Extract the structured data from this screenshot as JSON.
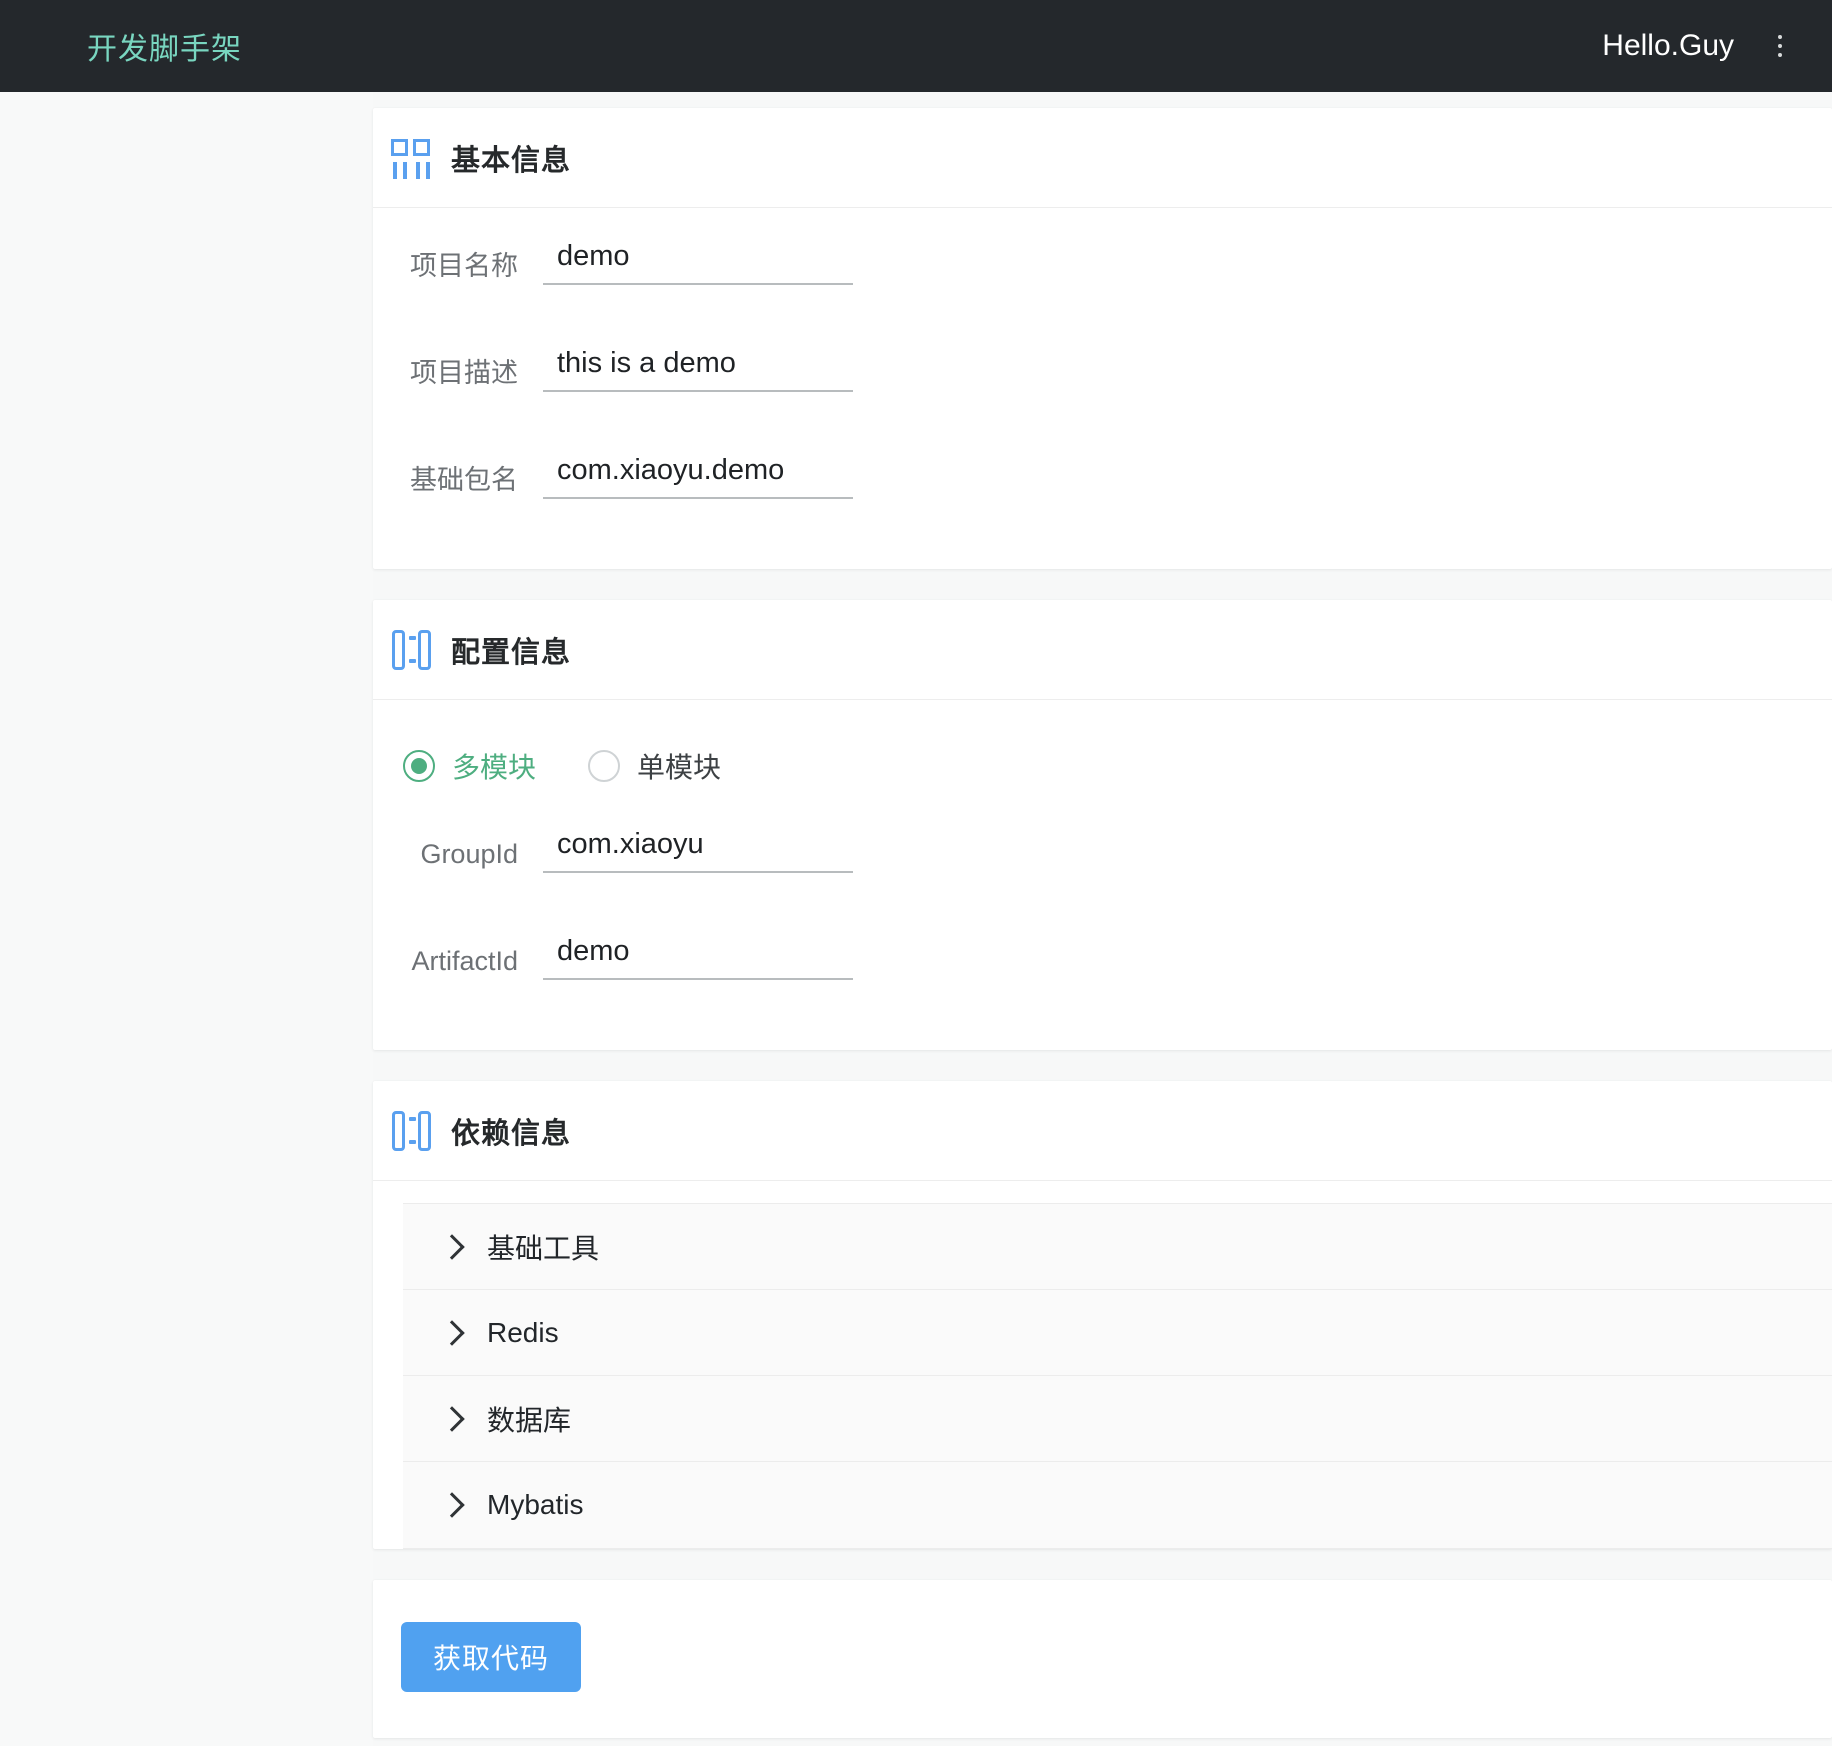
{
  "header": {
    "brand": "开发脚手架",
    "user": "Hello.Guy",
    "more_icon": "vertical-dots-icon"
  },
  "colors": {
    "navbar_bg": "#24282c",
    "brand_text": "#79d6c0",
    "icon_blue": "#5aa0ef",
    "radio_green": "#4eae80",
    "button_blue": "#50a1f0",
    "page_bg": "#f7f8f8"
  },
  "cards": {
    "basic": {
      "title": "基本信息",
      "icon": "form-layout-icon",
      "fields": [
        {
          "label": "项目名称",
          "value": "demo"
        },
        {
          "label": "项目描述",
          "value": "this is a demo"
        },
        {
          "label": "基础包名",
          "value": "com.xiaoyu.demo"
        }
      ]
    },
    "config": {
      "title": "配置信息",
      "icon": "columns-layout-icon",
      "radios": [
        {
          "label": "多模块",
          "checked": true
        },
        {
          "label": "单模块",
          "checked": false
        }
      ],
      "fields": [
        {
          "label": "GroupId",
          "value": "com.xiaoyu"
        },
        {
          "label": "ArtifactId",
          "value": "demo"
        }
      ]
    },
    "dependency": {
      "title": "依赖信息",
      "icon": "columns-layout-icon",
      "items": [
        {
          "label": "基础工具",
          "icon": "chevron-right-icon"
        },
        {
          "label": "Redis",
          "icon": "chevron-right-icon"
        },
        {
          "label": "数据库",
          "icon": "chevron-right-icon"
        },
        {
          "label": "Mybatis",
          "icon": "chevron-right-icon"
        }
      ]
    },
    "submit": {
      "button_label": "获取代码"
    }
  }
}
